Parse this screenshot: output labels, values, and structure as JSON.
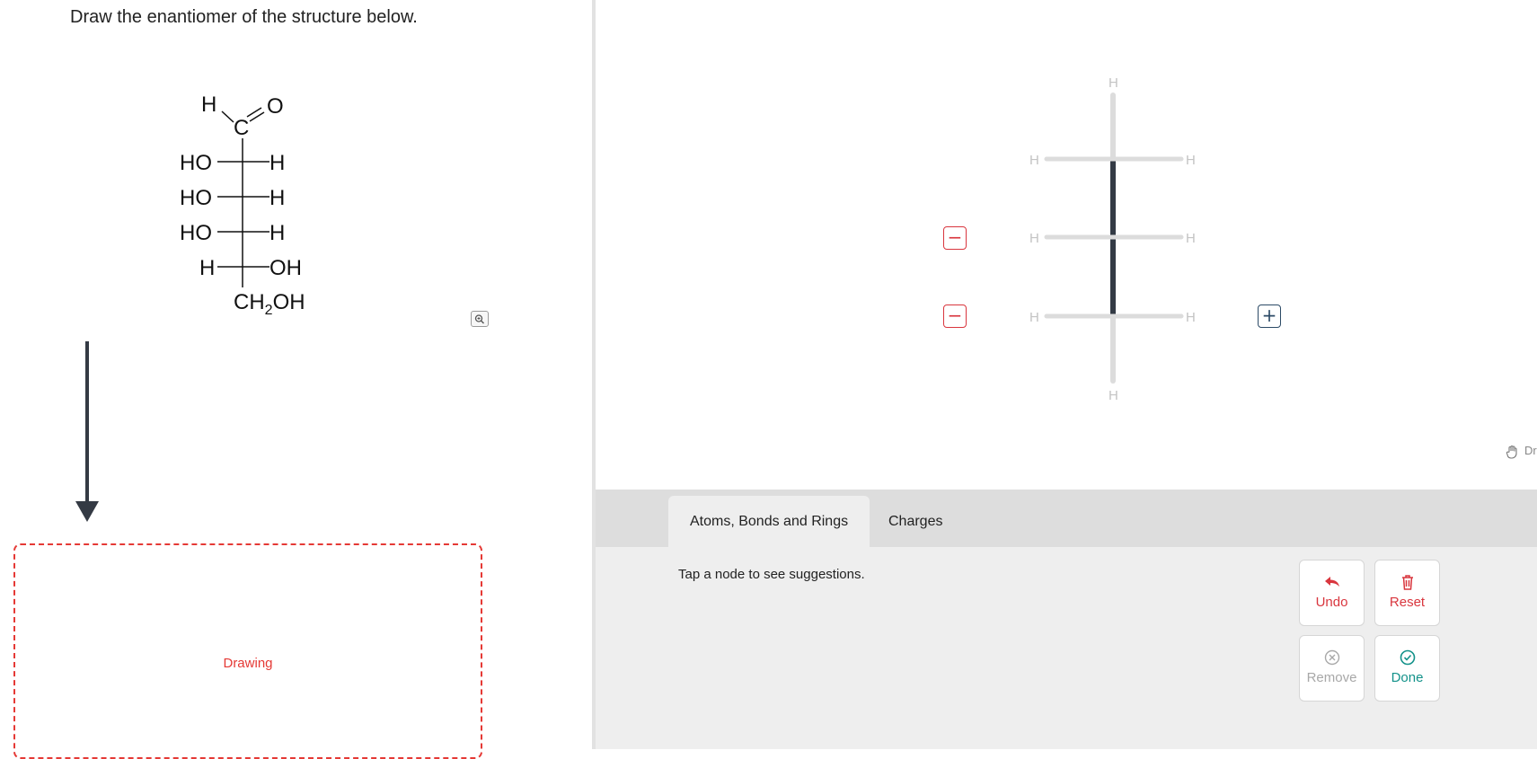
{
  "question": {
    "prompt": "Draw the enantiomer of the structure below.",
    "molecule": {
      "aldehyde_h": "H",
      "aldehyde_c": "C",
      "aldehyde_o": "O",
      "rows": [
        {
          "left": "HO",
          "right": "H"
        },
        {
          "left": "HO",
          "right": "H"
        },
        {
          "left": "HO",
          "right": "H"
        },
        {
          "left": "H",
          "right": "OH"
        }
      ],
      "bottom": {
        "ch": "CH",
        "sub": "2",
        "oh": "OH"
      }
    },
    "drawing_label": "Drawing"
  },
  "canvas": {
    "top_label": "H",
    "bottom_label": "H",
    "rows": [
      {
        "left": "H",
        "right": "H"
      },
      {
        "left": "H",
        "right": "H"
      },
      {
        "left": "H",
        "right": "H"
      }
    ],
    "minus_symbol": "−",
    "plus_symbol": "+",
    "drag_hint": "Dr"
  },
  "tabs": [
    {
      "label": "Atoms, Bonds and Rings",
      "active": true
    },
    {
      "label": "Charges",
      "active": false
    }
  ],
  "panel": {
    "hint": "Tap a node to see suggestions."
  },
  "actions": {
    "undo": "Undo",
    "reset": "Reset",
    "remove": "Remove",
    "done": "Done"
  },
  "colors": {
    "accent_red": "#d9363e",
    "teal": "#13928a",
    "bond_dark": "#333a45",
    "bond_light": "#dcdcdc"
  }
}
